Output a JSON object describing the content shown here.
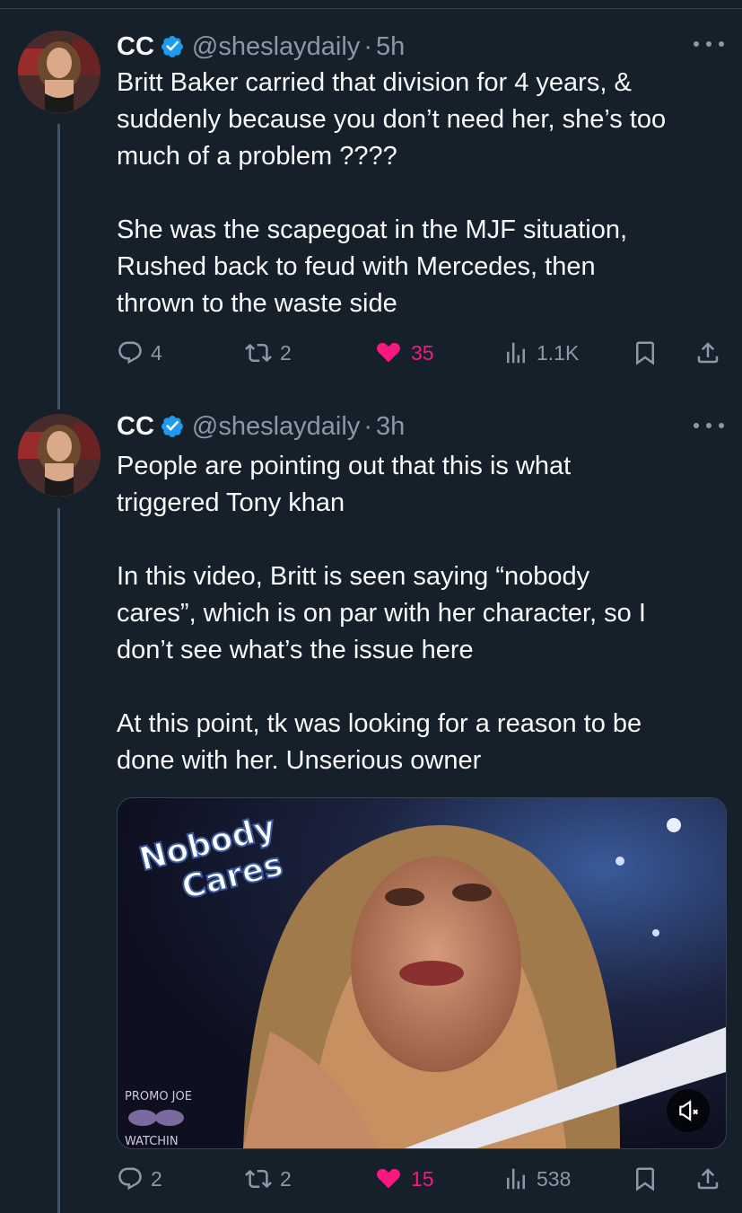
{
  "tweets": [
    {
      "author": "CC",
      "handle": "@sheslaydaily",
      "sep": "·",
      "time": "5h",
      "text": "Britt Baker carried that division for 4 years, &\nsuddenly because you don’t need her, she’s too\nmuch of a problem ????\n\nShe was the scapegoat in the MJF situation,\nRushed back to feud with Mercedes, then\nthrown to the waste side",
      "replies": "4",
      "reposts": "2",
      "likes": "35",
      "views": "1.1K"
    },
    {
      "author": "CC",
      "handle": "@sheslaydaily",
      "sep": "·",
      "time": "3h",
      "text": "People are pointing out that this is what\ntriggered Tony khan\n\nIn this video, Britt is seen saying “nobody\ncares”, which is on par with her character, so I\ndon’t see what’s the issue here\n\nAt this point, tk was looking for a reason to be\ndone with her. Unserious owner",
      "replies": "2",
      "reposts": "2",
      "likes": "15",
      "views": "538",
      "media": {
        "overlay_line1": "Nobody",
        "overlay_line2": "Cares",
        "watermark_line1": "PROMO JOE",
        "watermark_line2": "WATCHIN"
      }
    }
  ],
  "colors": {
    "background": "#15202b",
    "text": "#f7f9f9",
    "secondary": "#8b98a5",
    "like": "#f91880",
    "verified": "#1d9bf0"
  },
  "icons": [
    "verified-badge-icon",
    "more-icon",
    "reply-icon",
    "repost-icon",
    "like-icon",
    "views-icon",
    "bookmark-icon",
    "share-icon",
    "mute-icon"
  ]
}
